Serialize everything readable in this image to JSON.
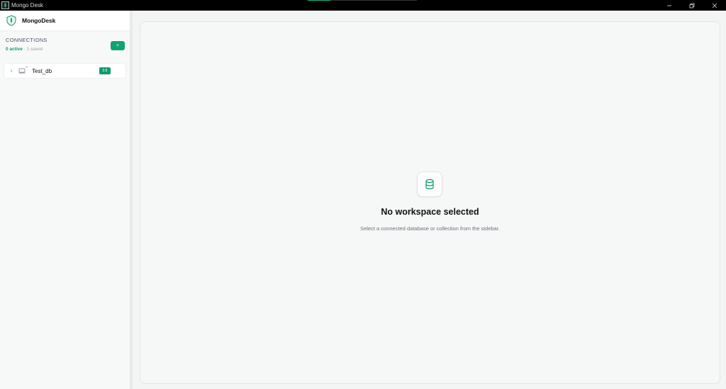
{
  "window": {
    "title": "Mongo Desk"
  },
  "brand": {
    "name": "MongoDesk"
  },
  "connections": {
    "title": "CONNECTIONS",
    "active_count": "0 active",
    "separator": " · ",
    "saved_count": "1 saved",
    "add_label": "+",
    "items": [
      {
        "label": "Test_db",
        "badge": "3.6"
      }
    ]
  },
  "main": {
    "empty_title": "No workspace selected",
    "empty_text": "Select a connected database or collection from the sidebar."
  },
  "colors": {
    "accent": "#10a372",
    "titlebar": "#000000",
    "background": "#f3f4f4"
  },
  "icons": {
    "app": "mongo-desk-app-icon",
    "logo": "mongodesk-shield-leaf-logo",
    "expand": "chevron-right-icon",
    "connection": "server-icon",
    "empty_state": "database-icon",
    "minimize": "minimize-icon",
    "restore": "restore-icon",
    "close": "close-icon"
  }
}
